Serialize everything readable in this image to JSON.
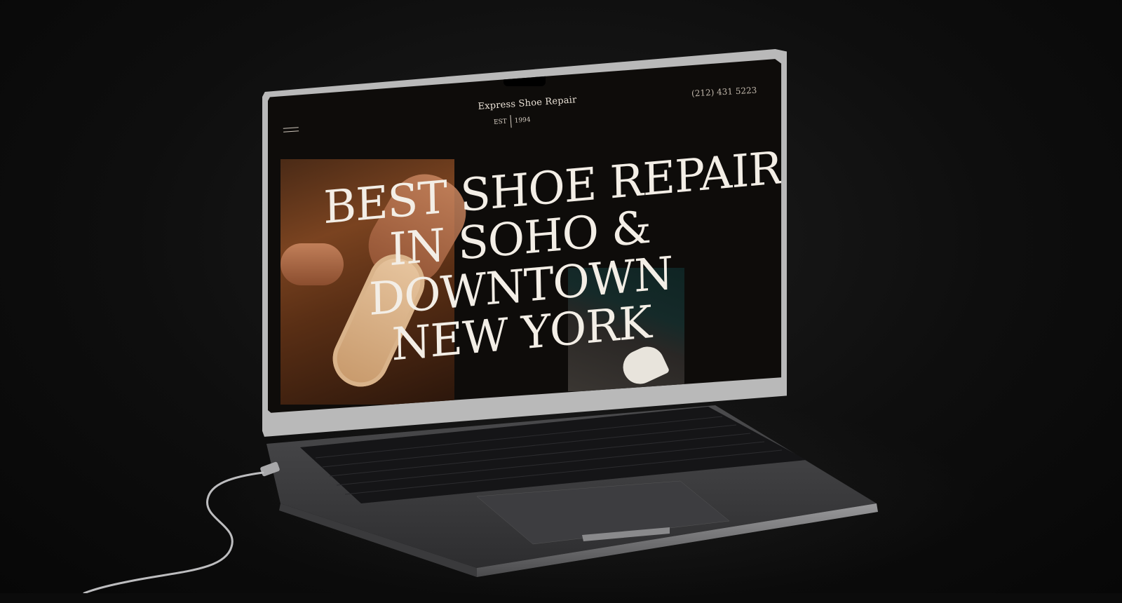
{
  "site": {
    "brand_name": "Express Shoe Repair",
    "est_label": "EST",
    "est_year": "1994",
    "phone": "(212) 431 5223",
    "menu_icon": "hamburger-menu-icon",
    "headline_lines": [
      "BEST SHOE REPAIR",
      "IN SOHO &",
      "DOWNTOWN",
      "NEW YORK"
    ]
  },
  "colors": {
    "background": "#0b0b0b",
    "screen_bg": "#0e0c0a",
    "text_light": "#f3eee6",
    "accent_leather": "#7a4320"
  }
}
